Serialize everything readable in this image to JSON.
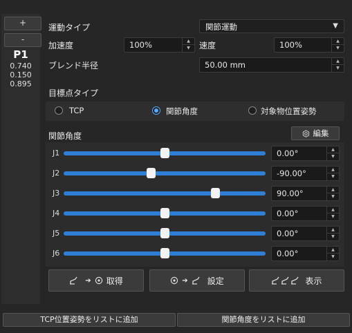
{
  "side": {
    "plus_label": "+",
    "minus_label": "-",
    "point_name": "P1",
    "values": [
      "0.740",
      "0.150",
      "0.895"
    ]
  },
  "motion": {
    "type_label": "運動タイプ",
    "type_value": "関節運動",
    "accel_label": "加速度",
    "accel_value": "100%",
    "speed_label": "速度",
    "speed_value": "100%",
    "blend_label": "ブレンド半径",
    "blend_value": "50.00 mm"
  },
  "target": {
    "type_label": "目標点タイプ",
    "options": [
      "TCP",
      "関節角度",
      "対象物位置姿勢"
    ],
    "selected": "関節角度"
  },
  "joints": {
    "section_label": "関節角度",
    "edit_label": "編集",
    "items": [
      {
        "name": "J1",
        "value": "0.00°",
        "fraction": 0.5
      },
      {
        "name": "J2",
        "value": "-90.00°",
        "fraction": 0.43
      },
      {
        "name": "J3",
        "value": "90.00°",
        "fraction": 0.75
      },
      {
        "name": "J4",
        "value": "0.00°",
        "fraction": 0.5
      },
      {
        "name": "J5",
        "value": "0.00°",
        "fraction": 0.5
      },
      {
        "name": "J6",
        "value": "0.00°",
        "fraction": 0.5
      }
    ]
  },
  "actions": {
    "get_label": "取得",
    "set_label": "設定",
    "show_label": "表示"
  },
  "bottom": {
    "add_tcp_label": "TCP位置姿勢をリストに追加",
    "add_joint_label": "関節角度をリストに追加"
  },
  "colors": {
    "accent": "#2f7fd6",
    "radio_selected": "#5aa9ff",
    "background": "#262626"
  },
  "icons": {
    "dropdown": "chevron-down-icon",
    "edit": "settings-icon",
    "robot": "robot-arm-icon",
    "location": "location-pin-icon",
    "arrow": "right-arrow-icon"
  }
}
